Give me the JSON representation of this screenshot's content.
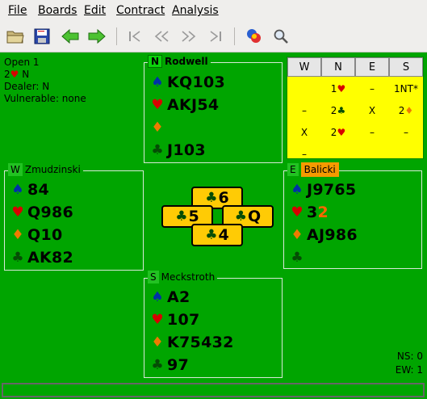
{
  "menubar": {
    "items": [
      {
        "label": "File"
      },
      {
        "label": "Boards"
      },
      {
        "label": "Edit"
      },
      {
        "label": "Contract"
      },
      {
        "label": "Analysis"
      }
    ]
  },
  "toolbar": {
    "buttons": [
      "open-folder-icon",
      "save-icon",
      "back-arrow-icon",
      "forward-arrow-icon",
      "first-trick-icon",
      "previous-trick-icon",
      "next-trick-icon",
      "last-trick-icon",
      "dealer-icon",
      "zoom-icon"
    ]
  },
  "info": {
    "board": "Open 1",
    "contract_level": "2",
    "contract_suit": "♥",
    "declarer": "N",
    "dealer": "Dealer: N",
    "vulnerable": "Vulnerable: none"
  },
  "north": {
    "seat": "N",
    "name": "Rodwell",
    "spades": "KQ103",
    "hearts": "AKJ54",
    "diamonds": "",
    "clubs": "J103"
  },
  "west": {
    "seat": "W",
    "name": "Zmudzinski",
    "spades": "84",
    "hearts": "Q986",
    "diamonds": "Q10",
    "clubs": "AK82"
  },
  "east": {
    "seat": "E",
    "name": "Balicki",
    "spades": "J9765",
    "hearts_main": "3",
    "hearts_played": "2",
    "diamonds": "AJ986",
    "clubs": ""
  },
  "south": {
    "seat": "S",
    "name": "Meckstroth",
    "spades": "A2",
    "hearts": "107",
    "diamonds": "K75432",
    "clubs": "97"
  },
  "bidding": {
    "headers": [
      "W",
      "N",
      "E",
      "S"
    ],
    "rows": [
      [
        "",
        "1♥",
        "–",
        "1NT*"
      ],
      [
        "–",
        "2♣",
        "X",
        "2♦"
      ],
      [
        "X",
        "2♥",
        "–",
        "–"
      ],
      [
        "–",
        "",
        "",
        ""
      ]
    ],
    "suit_colors": {
      "♥": "#d80000",
      "♦": "#ef7a00",
      "♣": "#054d05"
    }
  },
  "trick": {
    "north": {
      "suit": "♣",
      "rank": "6"
    },
    "west": {
      "suit": "♣",
      "rank": "5"
    },
    "east": {
      "suit": "♣",
      "rank": "Q"
    },
    "south": {
      "suit": "♣",
      "rank": "4"
    }
  },
  "score": {
    "ns": "NS: 0",
    "ew": "EW: 1"
  },
  "suits": {
    "spades": "♠",
    "hearts": "♥",
    "diamonds": "♦",
    "clubs": "♣"
  },
  "colors": {
    "table": "#00a500",
    "bidding_bg": "#ffff00",
    "card": "#ffcb05",
    "active_player": "#f59a00"
  }
}
